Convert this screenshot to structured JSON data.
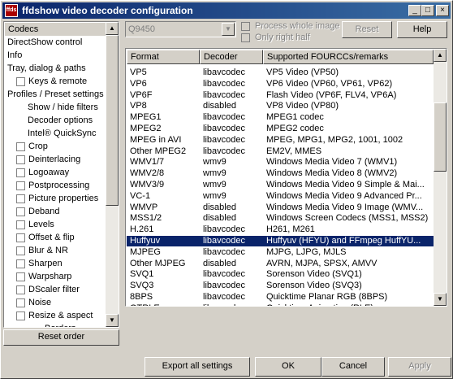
{
  "window": {
    "title": "ffdshow video decoder configuration",
    "icon_text": "ffds",
    "controls": {
      "minimize": "_",
      "maximize": "□",
      "close": "×"
    }
  },
  "sidebar": {
    "items": [
      {
        "label": "Codecs",
        "selected": true,
        "checkbox": false
      },
      {
        "label": "DirectShow control",
        "checkbox": false
      },
      {
        "label": "Info",
        "checkbox": false
      },
      {
        "label": "Tray, dialog & paths",
        "checkbox": false
      },
      {
        "label": "Keys & remote",
        "checkbox": true
      },
      {
        "label": "Profiles / Preset settings",
        "checkbox": false
      },
      {
        "label": "Show / hide filters",
        "checkbox": false
      },
      {
        "label": "Decoder options",
        "checkbox": false
      },
      {
        "label": "Intel® QuickSync",
        "checkbox": false
      },
      {
        "label": "Crop",
        "checkbox": true
      },
      {
        "label": "Deinterlacing",
        "checkbox": true
      },
      {
        "label": "Logoaway",
        "checkbox": true
      },
      {
        "label": "Postprocessing",
        "checkbox": true
      },
      {
        "label": "Picture properties",
        "checkbox": true
      },
      {
        "label": "Deband",
        "checkbox": true
      },
      {
        "label": "Levels",
        "checkbox": true
      },
      {
        "label": "Offset & flip",
        "checkbox": true
      },
      {
        "label": "Blur & NR",
        "checkbox": true
      },
      {
        "label": "Sharpen",
        "checkbox": true
      },
      {
        "label": "Warpsharp",
        "checkbox": true
      },
      {
        "label": "DScaler filter",
        "checkbox": true
      },
      {
        "label": "Noise",
        "checkbox": true
      },
      {
        "label": "Resize & aspect",
        "checkbox": true
      },
      {
        "label": "Borders",
        "checkbox": false
      }
    ],
    "reset_order": "Reset order"
  },
  "top": {
    "preset": "Q9450",
    "process_whole_image": "Process whole image",
    "only_right_half": "Only right half",
    "reset": "Reset",
    "help": "Help"
  },
  "table": {
    "columns": [
      "Format",
      "Decoder",
      "Supported FOURCCs/remarks"
    ],
    "rows": [
      [
        "VP5",
        "libavcodec",
        "VP5 Video (VP50)"
      ],
      [
        "VP6",
        "libavcodec",
        "VP6 Video (VP60, VP61, VP62)"
      ],
      [
        "VP6F",
        "libavcodec",
        "Flash Video (VP6F, FLV4, VP6A)"
      ],
      [
        "VP8",
        "disabled",
        "VP8 Video (VP80)"
      ],
      [
        "MPEG1",
        "libavcodec",
        "MPEG1 codec"
      ],
      [
        "MPEG2",
        "libavcodec",
        "MPEG2 codec"
      ],
      [
        "MPEG in AVI",
        "libavcodec",
        "MPEG, MPG1, MPG2, 1001, 1002"
      ],
      [
        "Other MPEG2",
        "libavcodec",
        "EM2V, MMES"
      ],
      [
        "WMV1/7",
        "wmv9",
        "Windows Media Video 7 (WMV1)"
      ],
      [
        "WMV2/8",
        "wmv9",
        "Windows Media Video 8 (WMV2)"
      ],
      [
        "WMV3/9",
        "wmv9",
        "Windows Media Video 9 Simple & Mai..."
      ],
      [
        "VC-1",
        "wmv9",
        "Windows Media Video 9 Advanced Pr..."
      ],
      [
        "WMVP",
        "disabled",
        "Windows Media Video 9 Image (WMV..."
      ],
      [
        "MSS1/2",
        "disabled",
        "Windows Screen Codecs (MSS1, MSS2)"
      ],
      [
        "H.261",
        "libavcodec",
        "H261, M261"
      ],
      [
        "Huffyuv",
        "libavcodec",
        "Huffyuv (HFYU) and FFmpeg HuffYU..."
      ],
      [
        "MJPEG",
        "libavcodec",
        "MJPG, LJPG, MJLS"
      ],
      [
        "Other MJPEG",
        "disabled",
        "AVRN, MJPA, SPSX, AMVV"
      ],
      [
        "SVQ1",
        "libavcodec",
        "Sorenson Video (SVQ1)"
      ],
      [
        "SVQ3",
        "libavcodec",
        "Sorenson Video (SVQ3)"
      ],
      [
        "8BPS",
        "libavcodec",
        "Quicktime Planar RGB (8BPS)"
      ],
      [
        "QTRLE",
        "libavcodec",
        "Quicktime Animation (RLE)"
      ]
    ],
    "selected_index": 15
  },
  "footer": {
    "export": "Export all settings",
    "ok": "OK",
    "cancel": "Cancel",
    "apply": "Apply"
  }
}
